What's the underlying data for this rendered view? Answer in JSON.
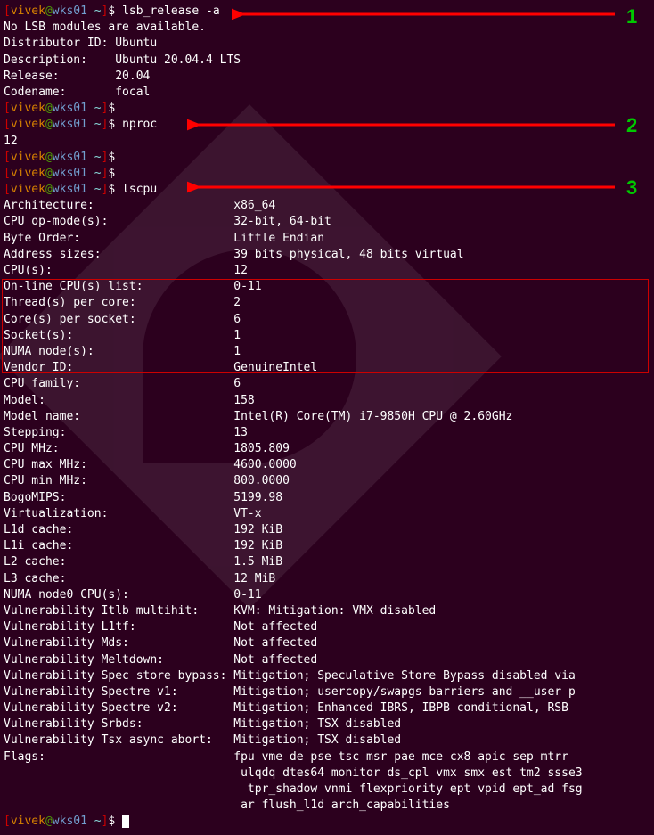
{
  "prompt": {
    "open": "[",
    "user": "vivek",
    "at": "@",
    "host": "wks01",
    "path": " ~",
    "close": "]",
    "dollar": "$ "
  },
  "cmd1": "lsb_release -a",
  "lsb": {
    "l0": "No LSB modules are available.",
    "l1": "Distributor ID: Ubuntu",
    "l2": "Description:    Ubuntu 20.04.4 LTS",
    "l3": "Release:        20.04",
    "l4": "Codename:       focal"
  },
  "cmd2": "nproc",
  "nproc_out": "12",
  "cmd3": "lscpu",
  "lscpu_labels": {
    "arch": "Architecture:",
    "opmode": "CPU op-mode(s):",
    "byteorder": "Byte Order:",
    "addrsizes": "Address sizes:",
    "cpus": "CPU(s):",
    "online": "On-line CPU(s) list:",
    "threads": "Thread(s) per core:",
    "cores": "Core(s) per socket:",
    "sockets": "Socket(s):",
    "numa": "NUMA node(s):",
    "vendor": "Vendor ID:",
    "family": "CPU family:",
    "model": "Model:",
    "modelname": "Model name:",
    "stepping": "Stepping:",
    "mhz": "CPU MHz:",
    "maxmhz": "CPU max MHz:",
    "minmhz": "CPU min MHz:",
    "bogomips": "BogoMIPS:",
    "virt": "Virtualization:",
    "l1d": "L1d cache:",
    "l1i": "L1i cache:",
    "l2": "L2 cache:",
    "l3": "L3 cache:",
    "numa0": "NUMA node0 CPU(s):",
    "vitlb": "Vulnerability Itlb multihit:",
    "vl1tf": "Vulnerability L1tf:",
    "vmds": "Vulnerability Mds:",
    "vmelt": "Vulnerability Meltdown:",
    "vssb": "Vulnerability Spec store bypass:",
    "vsv1": "Vulnerability Spectre v1:",
    "vsv2": "Vulnerability Spectre v2:",
    "vsrbds": "Vulnerability Srbds:",
    "vtsx": "Vulnerability Tsx async abort:",
    "flags": "Flags:"
  },
  "lscpu_values": {
    "arch": "x86_64",
    "opmode": "32-bit, 64-bit",
    "byteorder": "Little Endian",
    "addrsizes": "39 bits physical, 48 bits virtual",
    "cpus": "12",
    "online": "0-11",
    "threads": "2",
    "cores": "6",
    "sockets": "1",
    "numa": "1",
    "vendor": "GenuineIntel",
    "family": "6",
    "model": "158",
    "modelname": "Intel(R) Core(TM) i7-9850H CPU @ 2.60GHz",
    "stepping": "13",
    "mhz": "1805.809",
    "maxmhz": "4600.0000",
    "minmhz": "800.0000",
    "bogomips": "5199.98",
    "virt": "VT-x",
    "l1d": "192 KiB",
    "l1i": "192 KiB",
    "l2": "1.5 MiB",
    "l3": "12 MiB",
    "numa0": "0-11",
    "vitlb": "KVM: Mitigation: VMX disabled",
    "vl1tf": "Not affected",
    "vmds": "Not affected",
    "vmelt": "Not affected",
    "vssb": "Mitigation; Speculative Store Bypass disabled via",
    "vsv1": "Mitigation; usercopy/swapgs barriers and __user p",
    "vsv2": "Mitigation; Enhanced IBRS, IBPB conditional, RSB ",
    "vsrbds": "Mitigation; TSX disabled",
    "vtsx": "Mitigation; TSX disabled",
    "flags1": "fpu vme de pse tsc msr pae mce cx8 apic sep mtrr ",
    "flags2": " ulqdq dtes64 monitor ds_cpl vmx smx est tm2 ssse3",
    "flags3": "  tpr_shadow vnmi flexpriority ept vpid ept_ad fsg",
    "flags4": " ar flush_l1d arch_capabilities"
  },
  "annotations": {
    "n1": "1",
    "n2": "2",
    "n3": "3"
  }
}
